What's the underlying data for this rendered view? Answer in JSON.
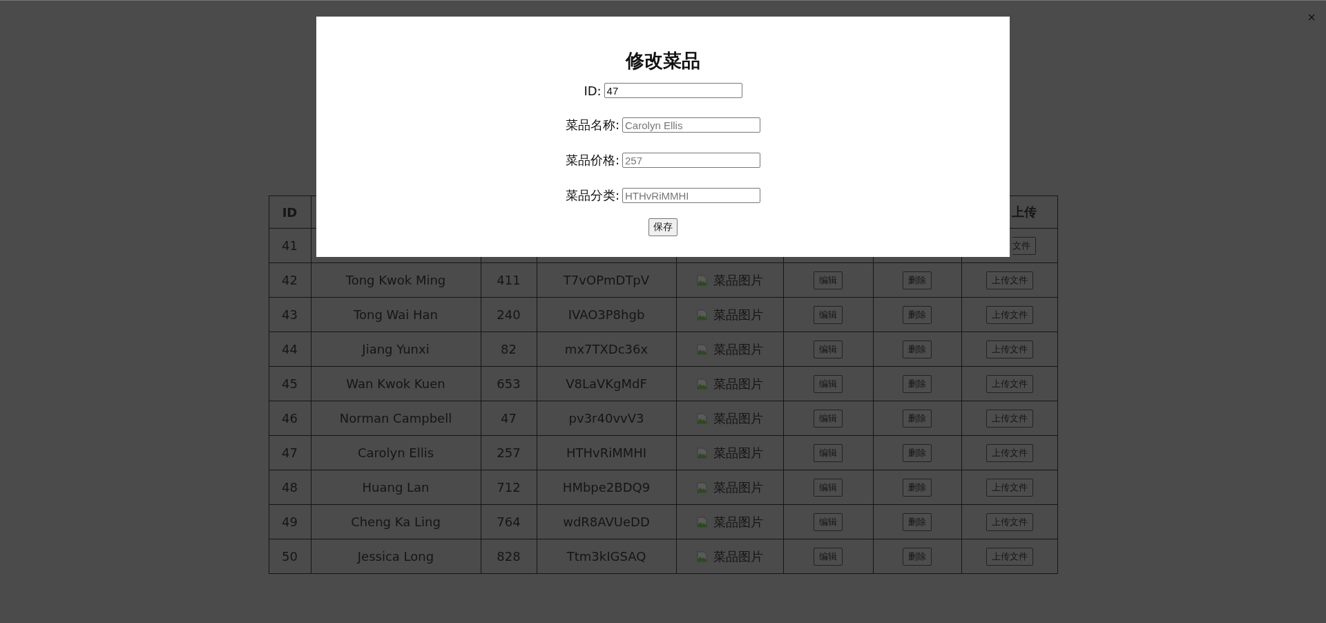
{
  "close_button": "×",
  "table": {
    "columns": [
      "ID",
      "",
      "",
      "",
      "",
      "",
      "",
      "上传"
    ],
    "rows": [
      {
        "id": "41",
        "upload": "文件"
      },
      {
        "id": "42",
        "name": "Tong Kwok Ming",
        "price": "411",
        "category": "T7vOPmDTpV",
        "image_alt": "菜品图片",
        "edit": "编辑",
        "delete": "删除",
        "upload": "上传文件"
      },
      {
        "id": "43",
        "name": "Tong Wai Han",
        "price": "240",
        "category": "IVAO3P8hgb",
        "image_alt": "菜品图片",
        "edit": "编辑",
        "delete": "删除",
        "upload": "上传文件"
      },
      {
        "id": "44",
        "name": "Jiang Yunxi",
        "price": "82",
        "category": "mx7TXDc36x",
        "image_alt": "菜品图片",
        "edit": "编辑",
        "delete": "删除",
        "upload": "上传文件"
      },
      {
        "id": "45",
        "name": "Wan Kwok Kuen",
        "price": "653",
        "category": "V8LaVKgMdF",
        "image_alt": "菜品图片",
        "edit": "编辑",
        "delete": "删除",
        "upload": "上传文件"
      },
      {
        "id": "46",
        "name": "Norman Campbell",
        "price": "47",
        "category": "pv3r40vvV3",
        "image_alt": "菜品图片",
        "edit": "编辑",
        "delete": "删除",
        "upload": "上传文件"
      },
      {
        "id": "47",
        "name": "Carolyn Ellis",
        "price": "257",
        "category": "HTHvRiMMHI",
        "image_alt": "菜品图片",
        "edit": "编辑",
        "delete": "删除",
        "upload": "上传文件"
      },
      {
        "id": "48",
        "name": "Huang Lan",
        "price": "712",
        "category": "HMbpe2BDQ9",
        "image_alt": "菜品图片",
        "edit": "编辑",
        "delete": "删除",
        "upload": "上传文件"
      },
      {
        "id": "49",
        "name": "Cheng Ka Ling",
        "price": "764",
        "category": "wdR8AVUeDD",
        "image_alt": "菜品图片",
        "edit": "编辑",
        "delete": "删除",
        "upload": "上传文件"
      },
      {
        "id": "50",
        "name": "Jessica Long",
        "price": "828",
        "category": "Ttm3kIGSAQ",
        "image_alt": "菜品图片",
        "edit": "编辑",
        "delete": "删除",
        "upload": "上传文件"
      }
    ]
  },
  "modal": {
    "title": "修改菜品",
    "fields": [
      {
        "label": "ID:",
        "value": "47"
      },
      {
        "label": "菜品名称:",
        "placeholder": "Carolyn Ellis"
      },
      {
        "label": "菜品价格:",
        "placeholder": "257"
      },
      {
        "label": "菜品分类:",
        "placeholder": "HTHvRiMMHI"
      }
    ],
    "save_button": "保存"
  }
}
